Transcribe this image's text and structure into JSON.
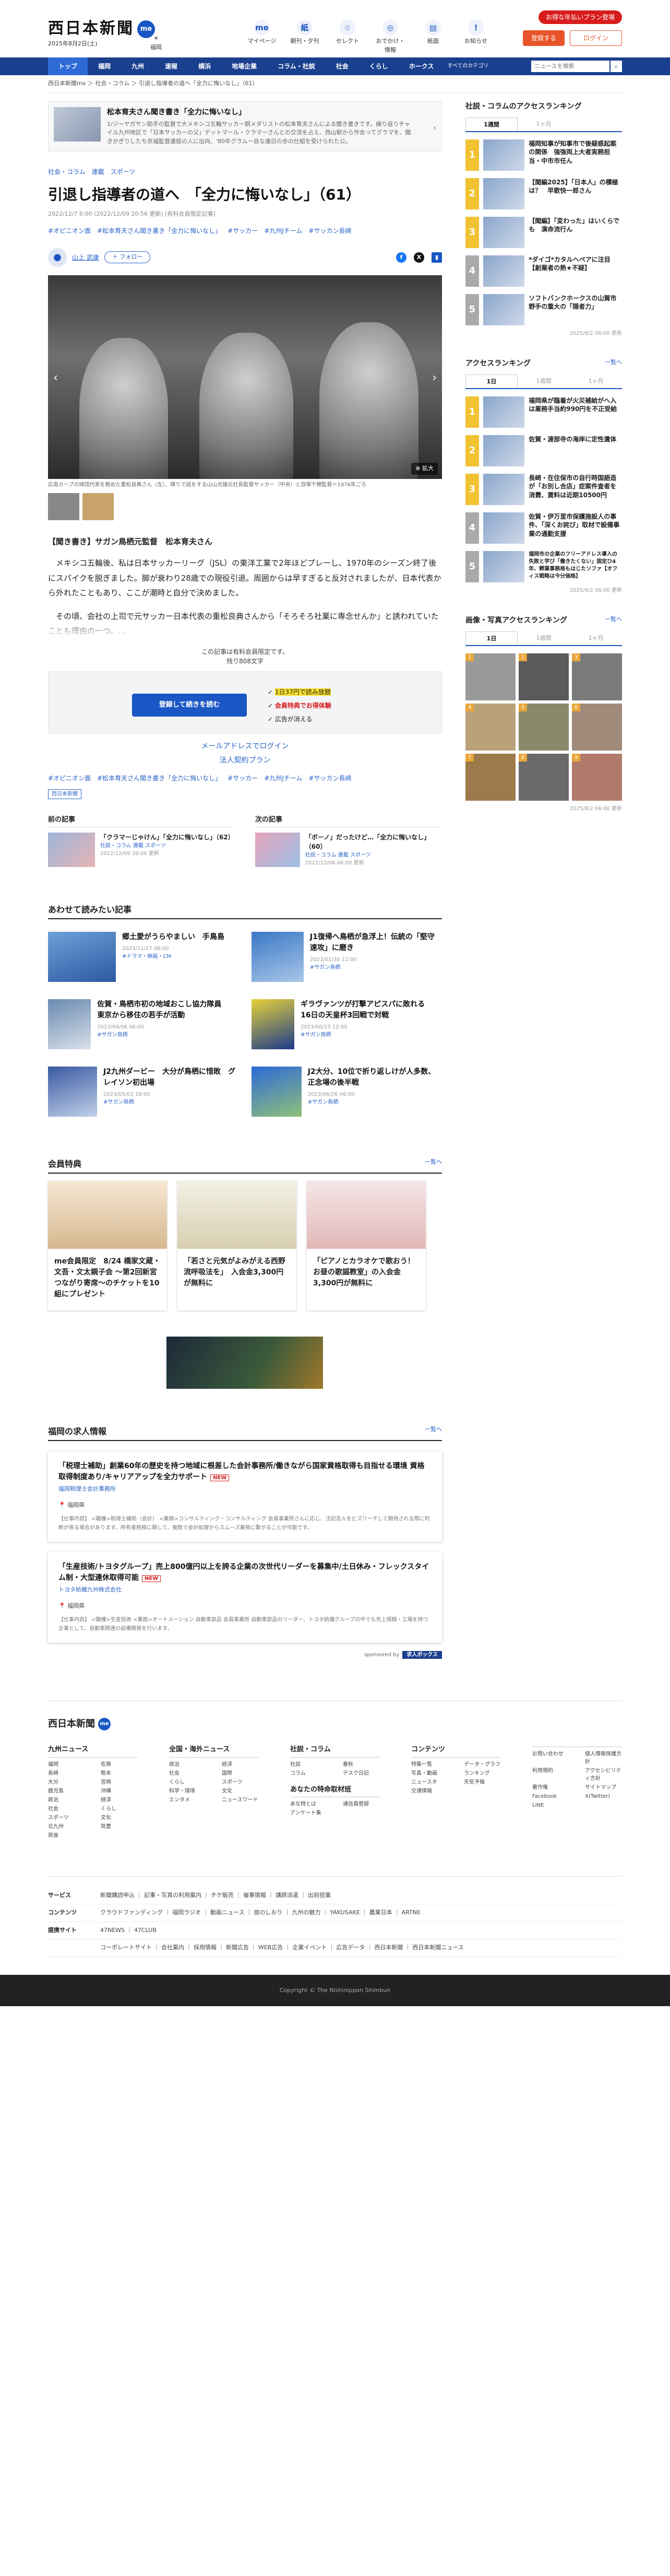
{
  "header": {
    "logo": "西日本新聞",
    "me": "me",
    "date": "2025年8月2日(土)",
    "weather": "福岡",
    "icons": [
      {
        "l": "マイページ",
        "g": "me"
      },
      {
        "l": "朝刊・夕刊",
        "g": "紙"
      },
      {
        "l": "セレクト",
        "g": "☆"
      },
      {
        "l": "おでかけ・情報",
        "g": "◎"
      },
      {
        "l": "紙面",
        "g": "▤"
      },
      {
        "l": "お知らせ",
        "g": "!"
      }
    ],
    "cta": "お得な年払いプラン登場",
    "register": "登録する",
    "login": "ログイン"
  },
  "nav": {
    "items": [
      "トップ",
      "福岡",
      "九州",
      "速報",
      "横浜",
      "地場企業",
      "コラム・社説",
      "社会",
      "くらし",
      "ホークス"
    ],
    "more": "すべてのカテゴリ",
    "search_placeholder": "ニュースを検索"
  },
  "breadcrumb": "西日本新聞me ＞ 社会・コラム ＞ 引退し指導者の道へ「全力に悔いなし」（61）",
  "related": {
    "title": "松本育夫さん聞き書き「全力に悔いなし」",
    "desc": "1/ジーヤガサン助手の監督で大メキシコ五輪サッカー銅メダリストの松本育夫さんによる聞き書きです。繰り返りチャイル九州地区で「日本サッカーの父」デットマール・クラマーさんとの交流を占え、西山駅から作会ってグラマを、聞きかぎりしたち京福監督連投の人に出向、'80年グラムー自な連日の歩の仕組を受けられた公。"
  },
  "article": {
    "categories": [
      "社会・コラム",
      "連載",
      "スポーツ"
    ],
    "title": "引退し指導者の道へ　「全力に悔いなし」（61）",
    "meta": "2022/12/7 6:00 (2022/12/09 20:56 更新) [有料会員限定記事]",
    "tags": [
      "#オピニオン面",
      "#松本育夫さん聞き書き「全力に悔いなし」",
      "#サッカー",
      "#九州Jチーム",
      "#サッカン長崎"
    ],
    "author": "山上 武康",
    "follow": "＋ フォロー",
    "zoom": "拡大",
    "caption": "広島カープの球団代表を務めた重松良典さん（左）、隣りで話をする山山光雄元社長監督サッカー（中央）と双塚千穂監督＝1976年ごろ",
    "lead": "【聞き書き】サガン鳥栖元監督　松本育夫さん",
    "paras": [
      "　メキシコ五輪後、私は日本サッカーリーグ（JSL）の東洋工業で2年ほどプレーし、1970年のシーズン終了後にスパイクを脱ぎました。脚が衰わり28歳での現役引退。周囲からは早すぎると反対されましたが、日本代表から外れたこともあり、ここが潮時と自分で決めました。",
      "　その頃、会社の上司で元サッカー日本代表の重松良典さんから「そろそろ社業に専念せんか」と誘われていたことも理由の一つ。…"
    ]
  },
  "paywall": {
    "line1": "この記事は有料会員限定です。",
    "line2": "残り808文字",
    "button": "登録して続きを読む",
    "benefits": [
      "1日37円で読み放題",
      "会員特典でお得体験",
      "広告が消える"
    ],
    "login": "メールアドレスでログイン",
    "corp": "法人契約プラン",
    "source": "西日本新聞"
  },
  "prevnext": {
    "prev": {
      "h": "前の記事",
      "t": "「クラマーじゃけん」「全力に悔いなし」（62）",
      "c": "社説・コラム 連載 スポーツ",
      "d": "2022/12/09 39:00 更新"
    },
    "next": {
      "h": "次の記事",
      "t": "「ボーノ」だったけど…「全力に悔いなし」（60）",
      "c": "社説・コラム 連載 スポーツ",
      "d": "2022/12/06 06:00 更新"
    }
  },
  "also": {
    "h": "あわせて読みたい記事",
    "items": [
      {
        "t": "郷土愛がうらやましい　手鳥島",
        "d": "2023/11/17 06:00",
        "g": "#ドラマ・映画・CM"
      },
      {
        "t": "J1復帰へ鳥栖が急浮上！伝統の「堅守速攻」に磨き",
        "d": "2023/01/30 12:00",
        "g": "#サガン鳥栖"
      },
      {
        "t": "佐賀・鳥栖市初の地域おこし協力隊員　東京から移住の若手が活動",
        "d": "2023/04/06 06:00",
        "g": "#サガン鳥栖"
      },
      {
        "t": "ギラヴァンツが打撃アピスパに敗れる　16日の天皇杯3回戦で対戦",
        "d": "2023/06/15 12:00",
        "g": "#サガン鳥栖"
      },
      {
        "t": "J2九州ダービー　大分が鳥栖に惜敗　グレイソン初出場",
        "d": "2023/05/03 18:00",
        "g": "#サガン鳥栖"
      },
      {
        "t": "J2大分、10位で折り返しけが人多数、正念場の後半戦",
        "d": "2023/06/26 06:00",
        "g": "#サガン鳥栖"
      }
    ]
  },
  "benefits": {
    "h": "会員特典",
    "more": "一覧へ",
    "items": [
      "me会員限定　8/24 橋家文蔵・文吾・文太親子会 〜第2回新宮つながり寄席〜のチケットを10組にプレゼント",
      "「若さと元気がよみがえる西野流呼吸法を」　入会金3,300円が無料に",
      "「ピアノとカラオケで歌おう！　お昼の歌謡教室」の入会金3,300円が無料に"
    ]
  },
  "jobs": {
    "h": "福岡の求人情報",
    "more": "一覧へ",
    "items": [
      {
        "t": "「税理士補助」創業60年の歴史を持つ地域に根差した会計事務所/働きながら国家資格取得も目指せる環境 資格取得制度あり/キャリアアップを全力サポート",
        "new": "NEW",
        "co": "福岡税理士会計事務所",
        "loc": "福岡県",
        "tx": "【仕事内容】 <職種>税理士補助（会計） <業務>コンサルティング・コンサルティング 会員事業所さんに応じ、注記及人をビズリーチして期待される際に判断が係る場合があります。所有者税務に関して、複数で会計処理からスムーズ業務に繋がることが可能です。"
      },
      {
        "t": "「生産技術/トヨタグループ」売上800億円以上を誇る企業の次世代リーダーを募集中/土日休み・フレックスタイム制・大型連休取得可能",
        "new": "NEW",
        "co": "トヨタ紡織九州株式会社",
        "loc": "福岡県",
        "tx": "【仕事内容】 <職種>生産技術 <業務>オートメーション 自動車部品 会員事業所 自動車部品のリーダー、トヨタ紡織グループの中でも売上規模・工場を持つ企業として、自動車関連の設備開発を行います。"
      }
    ],
    "sponsor": "sponsored by",
    "brand": "求人ボックス"
  },
  "sidebar": {
    "r1": {
      "h": "社説・コラムのアクセスランキング",
      "tabs": [
        "1週間",
        "1ヶ月"
      ],
      "items": [
        "福岡知事が知事市で後疑惑起案の関係　強強両上大者実務担当・中市市任ん",
        "【聞編2025】「日本人」の積極は？　早歌快一郎さん",
        "【聞編】「変わった」はいくらでも　演命流行ん",
        "*ダイゴ*カタルヘペアに注目　【創業者の熱★不疑】",
        "ソフトバンクホークスの山賀市野手の重大の「隠者力」"
      ],
      "upd": "2025/8/2 06:00 更新"
    },
    "r2": {
      "h": "アクセスランキング",
      "more": "一覧へ",
      "tabs": [
        "1日",
        "1週間",
        "1ヶ月"
      ],
      "items": [
        "福岡県が臨着が火災補給がへ入は業務手当約990円を不正受給",
        "佐賀・渡部寺の海岸に定性遺体",
        "長崎・在住保市の自行時国語造が「お別し合店」症案件査者を消費、賃料は近期10500円",
        "佐賀・伊万里市保護施設人の事件、「深くお詫び」取材で設備事業の通勤支援",
        "福岡市の企業のフリーアドレス導入の失敗と学び「働きたくない」固定ひ4年、孵業事務局もはじたソファ【オフィス戦略は今分価格】"
      ],
      "upd": "2025/8/2 06:00 更新"
    },
    "r3": {
      "h": "画像・写真アクセスランキング",
      "more": "一覧へ",
      "tabs": [
        "1日",
        "1週間",
        "1ヶ月"
      ],
      "upd": "2025/8/2 06:00 更新"
    }
  },
  "footer": {
    "logo": "西日本新聞",
    "me": "me",
    "cols": [
      {
        "h": "九州ニュース",
        "l": [
          "福岡",
          "佐賀",
          "長崎",
          "熊本",
          "大分",
          "宮崎",
          "鹿児島",
          "沖縄",
          "政治",
          "経済",
          "社会",
          "くらし",
          "スポーツ",
          "文化",
          "北九州",
          "筑豊",
          "筑後"
        ]
      },
      {
        "h": "全国・海外ニュース",
        "l": [
          "政治",
          "経済",
          "社会",
          "国際",
          "くらし",
          "スポーツ",
          "科学・環境",
          "文化",
          "エンタメ",
          "ニュースワード"
        ]
      },
      {
        "h": "社説・コラム",
        "l": [
          "社説",
          "春秋",
          "コラム",
          "デスク日記"
        ],
        "h2": "あなたの特命取材班",
        "l2": [
          "あな特とは",
          "通信員登録",
          "アンケート集"
        ]
      },
      {
        "h": "コンテンツ",
        "l": [
          "特集一覧",
          "データ・グラフ",
          "写真・動画",
          "ランキング",
          "ニュースタ",
          "天気予報",
          "交通情報"
        ]
      },
      {
        "h": "",
        "l": [
          "お問い合わせ",
          "個人情報保護方針",
          "利用規約",
          "アクセシビリティ方針",
          "著作権",
          "サイトマップ",
          "Facebook",
          "X(Twitter)",
          "LINE"
        ]
      }
    ],
    "rows": [
      {
        "k": "サービス",
        "v": "新聞購読申込 ｜ 記事・写真の利用案内 ｜ チケ販売 ｜ 催事情報 ｜ 講師派遣 ｜ 出前授業"
      },
      {
        "k": "コンテンツ",
        "v": "クラウドファンディング ｜ 福岡ラジオ ｜ 動画ニュース ｜ 旅のしおり ｜ 九州の魅力 ｜ YAKUSAKE ｜ 農業日本 ｜ ARTNE"
      },
      {
        "k": "提携サイト",
        "v": "47NEWS ｜ 47CLUB"
      }
    ],
    "corp": "コーポレートサイト ｜ 会社案内 ｜ 採用情報 ｜ 新聞広告 ｜ WEB広告 ｜ 企業イベント ｜ 広告データ ｜ 西日本新聞 ｜ 西日本新聞ニュース",
    "copy": "Copyright © The Nishinippon Shimbun"
  }
}
